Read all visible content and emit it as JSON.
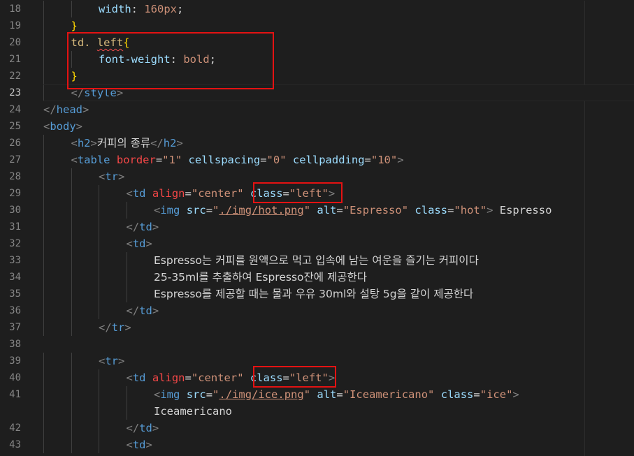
{
  "editor": {
    "colors": {
      "background": "#1e1e1e",
      "line_number": "#858585",
      "line_number_active": "#c6c6c6",
      "tag": "#569cd6",
      "bracket": "#808080",
      "attribute": "#9cdcfe",
      "attribute_special": "#f44747",
      "string": "#ce9178",
      "text": "#d4d4d4",
      "css_selector": "#d7ba7d",
      "css_property": "#9cdcfe",
      "css_value": "#ce9178",
      "brace": "#ffd700",
      "number": "#b5cea8",
      "highlight_box": "#e41212"
    },
    "lines": [
      {
        "num": "18",
        "indent": 2,
        "tokens": [
          {
            "t": "width",
            "c": "prop"
          },
          {
            "t": ": ",
            "c": "text"
          },
          {
            "t": "160px",
            "c": "value"
          },
          {
            "t": ";",
            "c": "text"
          }
        ]
      },
      {
        "num": "19",
        "indent": 1,
        "tokens": [
          {
            "t": "}",
            "c": "brace"
          }
        ]
      },
      {
        "num": "20",
        "indent": 1,
        "tokens": [
          {
            "t": "td. ",
            "c": "selector"
          },
          {
            "t": "left",
            "c": "selector",
            "squiggle": true
          },
          {
            "t": "{",
            "c": "brace"
          }
        ]
      },
      {
        "num": "21",
        "indent": 2,
        "tokens": [
          {
            "t": "font-weight",
            "c": "prop"
          },
          {
            "t": ": ",
            "c": "text"
          },
          {
            "t": "bold",
            "c": "value"
          },
          {
            "t": ";",
            "c": "text"
          }
        ]
      },
      {
        "num": "22",
        "indent": 1,
        "tokens": [
          {
            "t": "}",
            "c": "brace"
          }
        ]
      },
      {
        "num": "23",
        "indent": 1,
        "current": true,
        "tokens": [
          {
            "t": "</",
            "c": "bracket"
          },
          {
            "t": "style",
            "c": "tag"
          },
          {
            "t": ">",
            "c": "bracket"
          }
        ]
      },
      {
        "num": "24",
        "indent": 0,
        "tokens": [
          {
            "t": "</",
            "c": "bracket"
          },
          {
            "t": "head",
            "c": "tag"
          },
          {
            "t": ">",
            "c": "bracket"
          }
        ]
      },
      {
        "num": "25",
        "indent": 0,
        "tokens": [
          {
            "t": "<",
            "c": "bracket"
          },
          {
            "t": "body",
            "c": "tag"
          },
          {
            "t": ">",
            "c": "bracket"
          }
        ]
      },
      {
        "num": "26",
        "indent": 1,
        "tokens": [
          {
            "t": "<",
            "c": "bracket"
          },
          {
            "t": "h2",
            "c": "tag"
          },
          {
            "t": ">",
            "c": "bracket"
          },
          {
            "t": "커피의 종류",
            "c": "text",
            "kr": true
          },
          {
            "t": "</",
            "c": "bracket"
          },
          {
            "t": "h2",
            "c": "tag"
          },
          {
            "t": ">",
            "c": "bracket"
          }
        ]
      },
      {
        "num": "27",
        "indent": 1,
        "tokens": [
          {
            "t": "<",
            "c": "bracket"
          },
          {
            "t": "table",
            "c": "tag"
          },
          {
            "t": " ",
            "c": "text"
          },
          {
            "t": "border",
            "c": "special"
          },
          {
            "t": "=",
            "c": "text"
          },
          {
            "t": "\"1\"",
            "c": "string"
          },
          {
            "t": " ",
            "c": "text"
          },
          {
            "t": "cellspacing",
            "c": "attr"
          },
          {
            "t": "=",
            "c": "text"
          },
          {
            "t": "\"0\"",
            "c": "string"
          },
          {
            "t": " ",
            "c": "text"
          },
          {
            "t": "cellpadding",
            "c": "attr"
          },
          {
            "t": "=",
            "c": "text"
          },
          {
            "t": "\"10\"",
            "c": "string"
          },
          {
            "t": ">",
            "c": "bracket"
          }
        ]
      },
      {
        "num": "28",
        "indent": 2,
        "tokens": [
          {
            "t": "<",
            "c": "bracket"
          },
          {
            "t": "tr",
            "c": "tag"
          },
          {
            "t": ">",
            "c": "bracket"
          }
        ]
      },
      {
        "num": "29",
        "indent": 3,
        "tokens": [
          {
            "t": "<",
            "c": "bracket"
          },
          {
            "t": "td",
            "c": "tag"
          },
          {
            "t": " ",
            "c": "text"
          },
          {
            "t": "align",
            "c": "special"
          },
          {
            "t": "=",
            "c": "text"
          },
          {
            "t": "\"center\"",
            "c": "string"
          },
          {
            "t": " ",
            "c": "text"
          },
          {
            "t": "class",
            "c": "attr"
          },
          {
            "t": "=",
            "c": "text"
          },
          {
            "t": "\"left\"",
            "c": "string"
          },
          {
            "t": ">",
            "c": "bracket"
          }
        ]
      },
      {
        "num": "30",
        "indent": 4,
        "tokens": [
          {
            "t": "<",
            "c": "bracket"
          },
          {
            "t": "img",
            "c": "tag"
          },
          {
            "t": " ",
            "c": "text"
          },
          {
            "t": "src",
            "c": "attr"
          },
          {
            "t": "=",
            "c": "text"
          },
          {
            "t": "\"",
            "c": "string"
          },
          {
            "t": "./img/hot.png",
            "c": "string",
            "underline": true
          },
          {
            "t": "\"",
            "c": "string"
          },
          {
            "t": " ",
            "c": "text"
          },
          {
            "t": "alt",
            "c": "attr"
          },
          {
            "t": "=",
            "c": "text"
          },
          {
            "t": "\"Espresso\"",
            "c": "string"
          },
          {
            "t": " ",
            "c": "text"
          },
          {
            "t": "class",
            "c": "attr"
          },
          {
            "t": "=",
            "c": "text"
          },
          {
            "t": "\"hot\"",
            "c": "string"
          },
          {
            "t": ">",
            "c": "bracket"
          },
          {
            "t": " Espresso",
            "c": "text"
          }
        ]
      },
      {
        "num": "31",
        "indent": 3,
        "tokens": [
          {
            "t": "</",
            "c": "bracket"
          },
          {
            "t": "td",
            "c": "tag"
          },
          {
            "t": ">",
            "c": "bracket"
          }
        ]
      },
      {
        "num": "32",
        "indent": 3,
        "tokens": [
          {
            "t": "<",
            "c": "bracket"
          },
          {
            "t": "td",
            "c": "tag"
          },
          {
            "t": ">",
            "c": "bracket"
          }
        ]
      },
      {
        "num": "33",
        "indent": 4,
        "tokens": [
          {
            "t": "Espresso는 커피를 원액으로 먹고 입속에 남는 여운을 즐기는 커피이다",
            "c": "text",
            "kr": true
          }
        ]
      },
      {
        "num": "34",
        "indent": 4,
        "tokens": [
          {
            "t": "25-35ml를 추출하여 Espresso잔에 제공한다",
            "c": "text",
            "kr": true
          }
        ]
      },
      {
        "num": "35",
        "indent": 4,
        "tokens": [
          {
            "t": "Espresso를 제공할 때는 물과 우유 30ml와 설탕 5g을 같이 제공한다",
            "c": "text",
            "kr": true
          }
        ]
      },
      {
        "num": "36",
        "indent": 3,
        "tokens": [
          {
            "t": "</",
            "c": "bracket"
          },
          {
            "t": "td",
            "c": "tag"
          },
          {
            "t": ">",
            "c": "bracket"
          }
        ]
      },
      {
        "num": "37",
        "indent": 2,
        "tokens": [
          {
            "t": "</",
            "c": "bracket"
          },
          {
            "t": "tr",
            "c": "tag"
          },
          {
            "t": ">",
            "c": "bracket"
          }
        ]
      },
      {
        "num": "38",
        "indent": 0,
        "tokens": []
      },
      {
        "num": "39",
        "indent": 2,
        "tokens": [
          {
            "t": "<",
            "c": "bracket"
          },
          {
            "t": "tr",
            "c": "tag"
          },
          {
            "t": ">",
            "c": "bracket"
          }
        ]
      },
      {
        "num": "40",
        "indent": 3,
        "tokens": [
          {
            "t": "<",
            "c": "bracket"
          },
          {
            "t": "td",
            "c": "tag"
          },
          {
            "t": " ",
            "c": "text"
          },
          {
            "t": "align",
            "c": "special"
          },
          {
            "t": "=",
            "c": "text"
          },
          {
            "t": "\"center\"",
            "c": "string"
          },
          {
            "t": " ",
            "c": "text"
          },
          {
            "t": "class",
            "c": "attr"
          },
          {
            "t": "=",
            "c": "text"
          },
          {
            "t": "\"left\"",
            "c": "string"
          },
          {
            "t": ">",
            "c": "bracket"
          }
        ]
      },
      {
        "num": "41",
        "indent": 4,
        "tokens": [
          {
            "t": "<",
            "c": "bracket"
          },
          {
            "t": "img",
            "c": "tag"
          },
          {
            "t": " ",
            "c": "text"
          },
          {
            "t": "src",
            "c": "attr"
          },
          {
            "t": "=",
            "c": "text"
          },
          {
            "t": "\"",
            "c": "string"
          },
          {
            "t": "./img/ice.png",
            "c": "string",
            "underline": true
          },
          {
            "t": "\"",
            "c": "string"
          },
          {
            "t": " ",
            "c": "text"
          },
          {
            "t": "alt",
            "c": "attr"
          },
          {
            "t": "=",
            "c": "text"
          },
          {
            "t": "\"Iceamericano\"",
            "c": "string"
          },
          {
            "t": " ",
            "c": "text"
          },
          {
            "t": "class",
            "c": "attr"
          },
          {
            "t": "=",
            "c": "text"
          },
          {
            "t": "\"ice\"",
            "c": "string"
          },
          {
            "t": ">",
            "c": "bracket"
          }
        ]
      },
      {
        "num": "",
        "indent": 4,
        "tokens": [
          {
            "t": "Iceamericano",
            "c": "text"
          }
        ]
      },
      {
        "num": "42",
        "indent": 3,
        "tokens": [
          {
            "t": "</",
            "c": "bracket"
          },
          {
            "t": "td",
            "c": "tag"
          },
          {
            "t": ">",
            "c": "bracket"
          }
        ]
      },
      {
        "num": "43",
        "indent": 3,
        "tokens": [
          {
            "t": "<",
            "c": "bracket"
          },
          {
            "t": "td",
            "c": "tag"
          },
          {
            "t": ">",
            "c": "bracket"
          }
        ]
      }
    ]
  }
}
